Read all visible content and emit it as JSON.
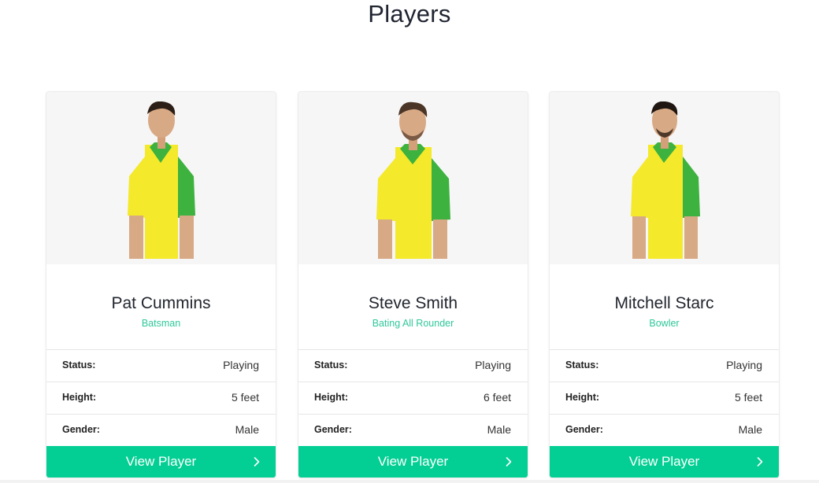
{
  "page": {
    "title": "Players"
  },
  "colors": {
    "accent": "#03cf94",
    "role_text": "#2fc89a",
    "photo_background": "#f6f6f6",
    "jersey_yellow": "#f4e92b",
    "jersey_green": "#3db23f"
  },
  "labels": {
    "status": "Status:",
    "height": "Height:",
    "gender": "Gender:",
    "view_player": "View Player"
  },
  "players": [
    {
      "name": "Pat Cummins",
      "role": "Batsman",
      "status": "Playing",
      "height": "5 feet",
      "gender": "Male",
      "photo_icon": "player-photo"
    },
    {
      "name": "Steve Smith",
      "role": "Bating All Rounder",
      "status": "Playing",
      "height": "6 feet",
      "gender": "Male",
      "photo_icon": "player-photo"
    },
    {
      "name": "Mitchell Starc",
      "role": "Bowler",
      "status": "Playing",
      "height": "5 feet",
      "gender": "Male",
      "photo_icon": "player-photo"
    }
  ]
}
